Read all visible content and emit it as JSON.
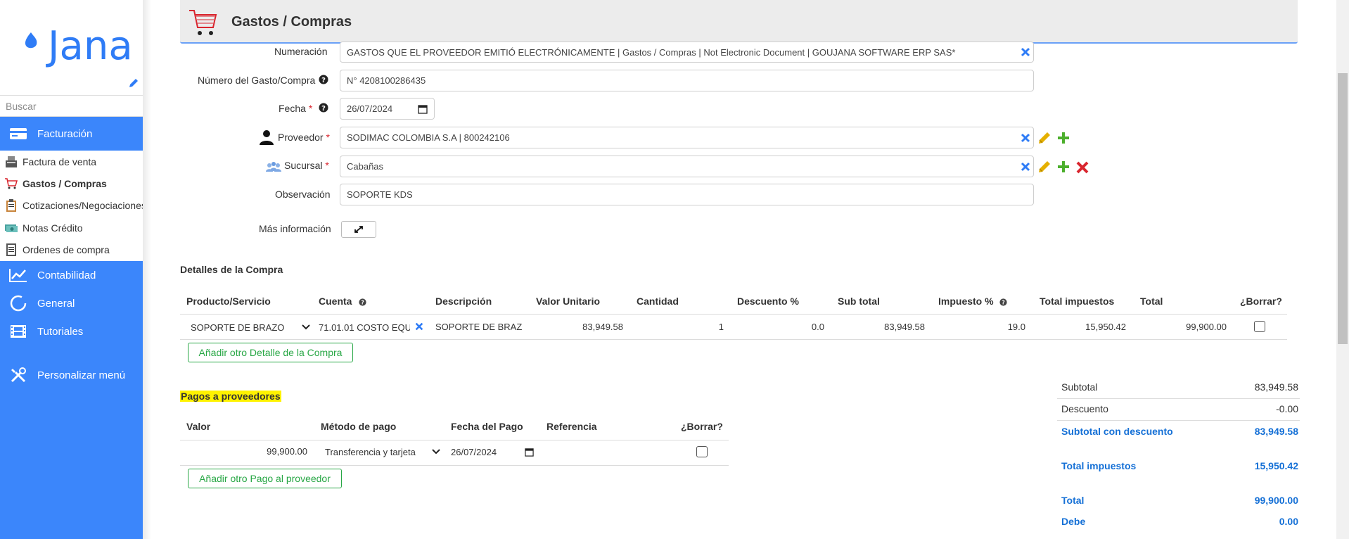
{
  "sidebar": {
    "logo_text": "Jana",
    "search_placeholder": "Buscar",
    "sections": {
      "facturacion": "Facturación",
      "contabilidad": "Contabilidad",
      "general": "General",
      "tutoriales": "Tutoriales",
      "personalizar": "Personalizar menú"
    },
    "items": [
      {
        "label": "Factura de venta",
        "icon": "cash-register-icon"
      },
      {
        "label": "Gastos / Compras",
        "icon": "cart-icon"
      },
      {
        "label": "Cotizaciones/Negociaciones",
        "icon": "clipboard-icon"
      },
      {
        "label": "Notas Crédito",
        "icon": "money-icon"
      },
      {
        "label": "Ordenes de compra",
        "icon": "receipt-icon"
      }
    ],
    "accent": "#3b86fb"
  },
  "header": {
    "title": "Gastos / Compras"
  },
  "form": {
    "numeracion": {
      "label": "Numeración",
      "value": "GASTOS QUE EL PROVEEDOR EMITIÓ ELECTRÓNICAMENTE | Gastos / Compras | Not Electronic Document | GOUJANA SOFTWARE ERP SAS*"
    },
    "numero": {
      "label": "Número del Gasto/Compra",
      "value": "N° 4208100286435"
    },
    "fecha": {
      "label": "Fecha",
      "value": "26/07/2024"
    },
    "proveedor": {
      "label": "Proveedor",
      "value": "SODIMAC COLOMBIA S.A | 800242106"
    },
    "sucursal": {
      "label": "Sucursal",
      "value": "Cabañas"
    },
    "observacion": {
      "label": "Observación",
      "value": "SOPORTE KDS"
    },
    "mas_info": {
      "label": "Más información"
    },
    "required_mark": "*"
  },
  "detalles": {
    "title": "Detalles de la Compra",
    "headers": [
      "Producto/Servicio",
      "Cuenta",
      "Descripción",
      "Valor Unitario",
      "Cantidad",
      "Descuento %",
      "Sub total",
      "Impuesto %",
      "Total impuestos",
      "Total",
      "¿Borrar?"
    ],
    "row": {
      "producto": "SOPORTE DE BRAZO",
      "cuenta": "71.01.01 COSTO EQUI",
      "descripcion": "SOPORTE DE BRAZ",
      "valor_unitario": "83,949.58",
      "cantidad": "1",
      "descuento": "0.0",
      "sub_total": "83,949.58",
      "impuesto": "19.0",
      "total_impuestos": "15,950.42",
      "total": "99,900.00"
    },
    "add_button": "Añadir otro Detalle de la Compra"
  },
  "pagos": {
    "title": "Pagos a proveedores",
    "headers": [
      "Valor",
      "Método de pago",
      "Fecha del Pago",
      "Referencia",
      "¿Borrar?"
    ],
    "row": {
      "valor": "99,900.00",
      "metodo": "Transferencia y tarjeta",
      "fecha": "26/07/2024",
      "referencia": ""
    },
    "add_button": "Añadir otro Pago al proveedor"
  },
  "totals": [
    {
      "label": "Subtotal",
      "value": "83,949.58"
    },
    {
      "label": "Descuento",
      "value": "-0.00"
    },
    {
      "label": "Subtotal con descuento",
      "value": "83,949.58"
    },
    {
      "label": "Total impuestos",
      "value": "15,950.42"
    },
    {
      "label": "Total",
      "value": "99,900.00"
    },
    {
      "label": "Debe",
      "value": "0.00"
    }
  ],
  "colors": {
    "accent_blue": "#3b86fb",
    "totals_blue": "#1570d6",
    "add_green": "#28a745",
    "edit_yellow": "#e5b000",
    "delete_red": "#d9262f"
  }
}
